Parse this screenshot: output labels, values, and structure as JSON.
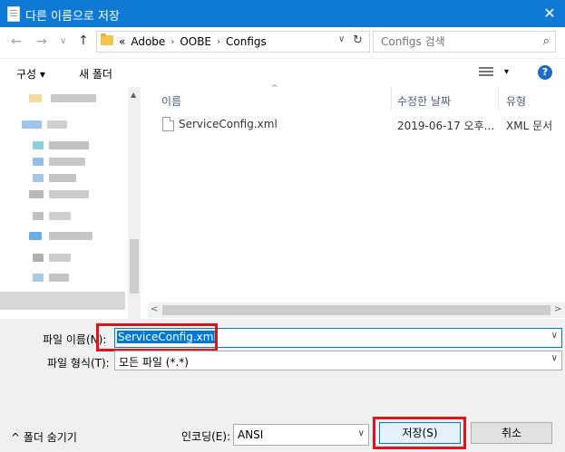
{
  "window": {
    "title": "다른 이름으로 저장",
    "close_glyph": "✕"
  },
  "nav": {
    "back": "←",
    "forward": "→",
    "recent": "∨",
    "up": "↑"
  },
  "address": {
    "overflow": "«",
    "crumbs": [
      "Adobe",
      "OOBE",
      "Configs"
    ],
    "separator": "›"
  },
  "search": {
    "placeholder": "Configs 검색"
  },
  "toolbar": {
    "organize": "구성 ▾",
    "new_folder": "새 폴더",
    "view_dd": "▾",
    "help": "?"
  },
  "columns": {
    "name": "이름",
    "modified": "수정한 날짜",
    "type": "유형"
  },
  "files": [
    {
      "name": "ServiceConfig.xml",
      "modified": "2019-06-17 오후...",
      "type": "XML 문서"
    }
  ],
  "form": {
    "filename_label": "파일 이름(N):",
    "filename_value": "ServiceConfig.xml",
    "filetype_label": "파일 형식(T):",
    "filetype_value": "모든 파일 (*.*)"
  },
  "footer": {
    "hide_folders": "^ 폴더 숨기기",
    "encoding_label": "인코딩(E):",
    "encoding_value": "ANSI",
    "save": "저장(S)",
    "cancel": "취소"
  },
  "colors": {
    "titlebar": "#0f79d6",
    "highlight": "#e0131c",
    "accent": "#0078d7"
  }
}
